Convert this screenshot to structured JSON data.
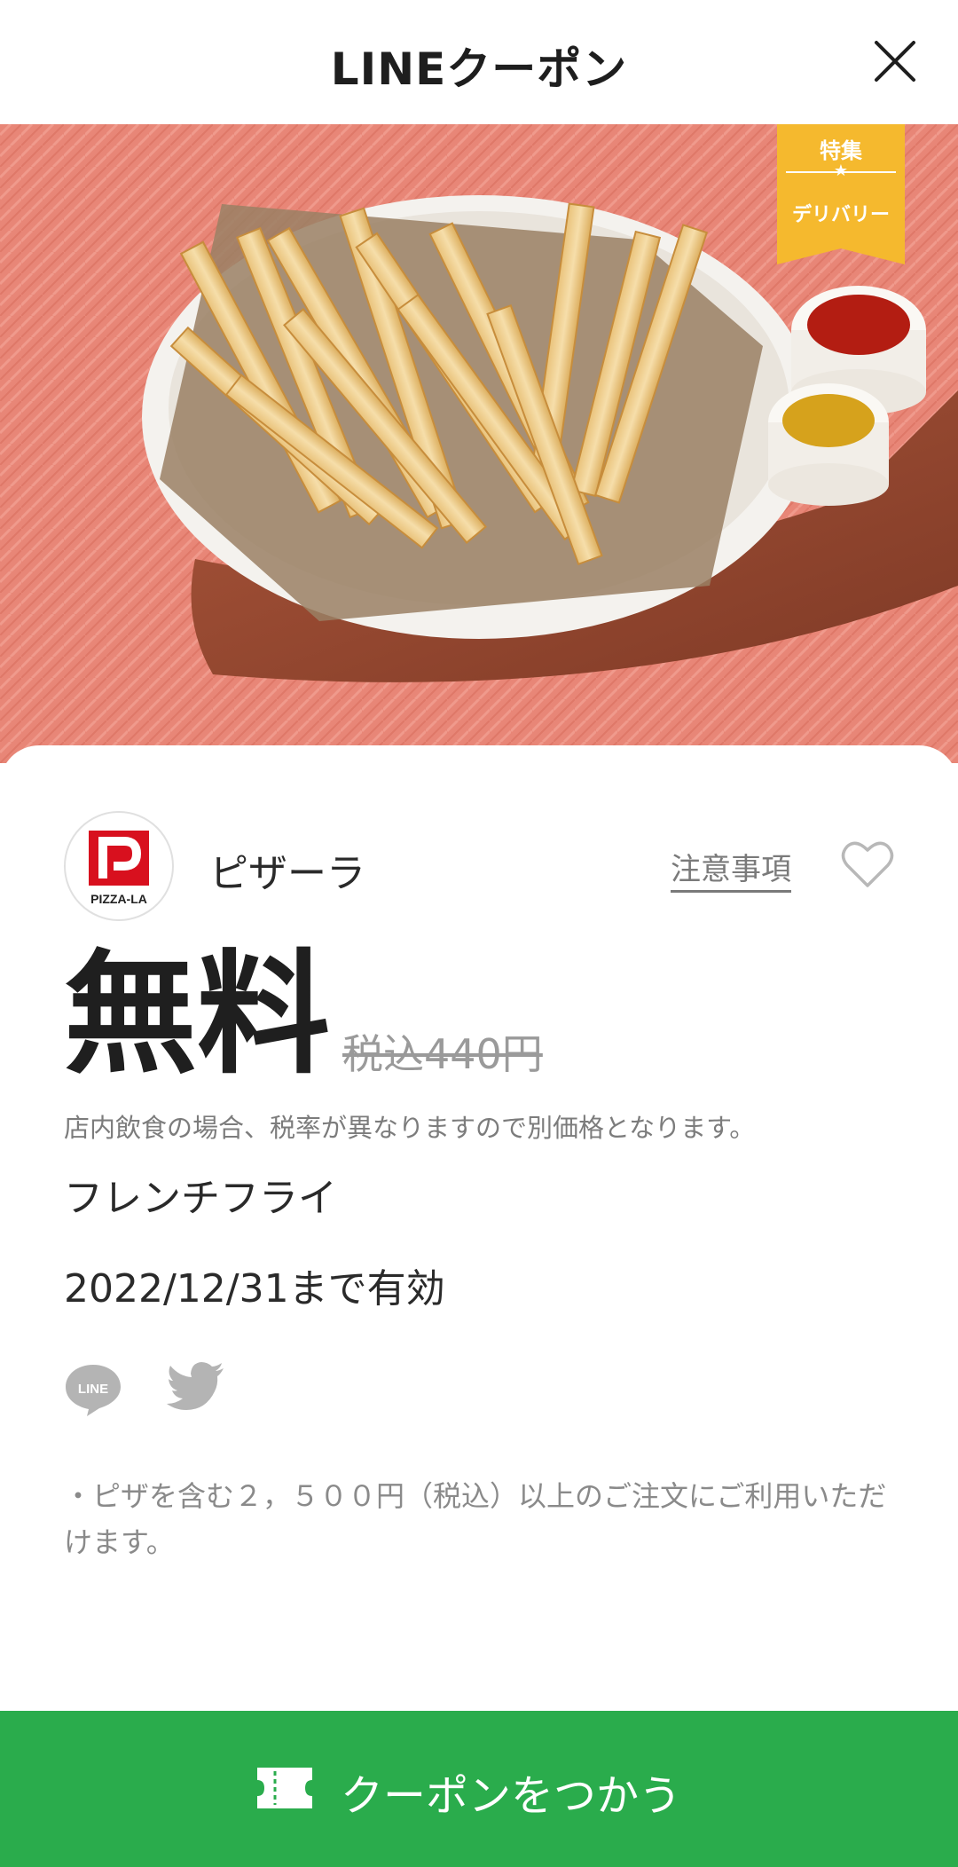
{
  "header": {
    "title": "LINEクーポン"
  },
  "hero": {
    "ribbon_top": "特集",
    "ribbon_star": "★",
    "ribbon_bottom": "デリバリー"
  },
  "shop": {
    "name": "ピザーラ",
    "logo_text": "PIZZA-LA"
  },
  "notice_link": "注意事項",
  "price": {
    "main": "無料",
    "original": "税込440円"
  },
  "tax_note": "店内飲食の場合、税率が異なりますので別価格となります。",
  "item_name": "フレンチフライ",
  "validity": "2022/12/31まで有効",
  "share": {
    "line_label": "LINE"
  },
  "conditions": "・ピザを含む２，５００円（税込）以上のご注文にご利用いただけます。",
  "use_button": {
    "label": "クーポンをつかう"
  },
  "colors": {
    "accent_green": "#2aac4c",
    "ribbon_yellow": "#f5b92e",
    "brand_red": "#d8101e"
  }
}
